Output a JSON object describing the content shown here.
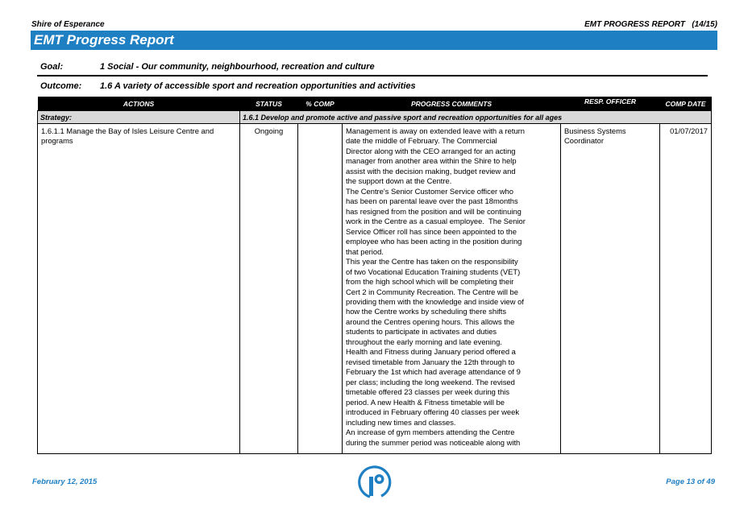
{
  "header": {
    "organisation": "Shire of Esperance",
    "report_label": "EMT PROGRESS REPORT",
    "report_period": "(14/15)",
    "banner_title": "EMT Progress Report"
  },
  "goal": {
    "label": "Goal:",
    "text": "1 Social - Our community, neighbourhood, recreation and culture"
  },
  "outcome": {
    "label": "Outcome:",
    "text": "1.6 A variety of accessible sport and recreation opportunities and activities"
  },
  "table": {
    "columns": [
      "ACTIONS",
      "STATUS",
      "% COMP",
      "PROGRESS COMMENTS",
      "RESP. OFFICER",
      "COMP DATE"
    ],
    "strategy_label": "Strategy:",
    "strategy_text": "1.6.1 Develop and promote active and passive sport and recreation opportunities for all ages",
    "rows": [
      {
        "action": "1.6.1.1 Manage the Bay of Isles Leisure Centre and programs",
        "status": "Ongoing",
        "percent_complete": "",
        "comment_lines": [
          "Management is away on extended leave with a return",
          "date the middle of February. The Commercial",
          "Director along with the CEO arranged for an acting",
          "manager from another area within the Shire to help",
          "assist with the decision making, budget review and",
          "the support down at the Centre.",
          "The Centre's Senior Customer Service officer who",
          "has been on parental leave over the past 18months",
          "has resigned from the position and will be continuing",
          "work in the Centre as a casual employee.  The Senior",
          "Service Officer roll has since been appointed to the",
          "employee who has been acting in the position during",
          "that period.",
          "This year the Centre has taken on the responsibility",
          "of two Vocational Education Training students (VET)",
          "from the high school which will be completing their",
          "Cert 2 in Community Recreation. The Centre will be",
          "providing them with the knowledge and inside view of",
          "how the Centre works by scheduling there shifts",
          "around the Centres opening hours. This allows the",
          "students to participate in activates and duties",
          "throughout the early morning and late evening.",
          "Health and Fitness during January period offered a",
          "revised timetable from January the 12th through to",
          "February the 1st which had average attendance of 9",
          "per class; including the long weekend. The revised",
          "timetable offered 23 classes per week during this",
          "period. A new Health & Fitness timetable will be",
          "introduced in February offering 40 classes per week",
          "including new times and classes.",
          "An increase of gym members attending the Centre",
          "during the summer period was noticeable along with"
        ],
        "responsible_officer": "Business Systems Coordinator",
        "completion_date": "01/07/2017"
      }
    ]
  },
  "footer": {
    "date": "February 12, 2015",
    "page": "Page 13 of 49",
    "logo_icon": "info-i-logo-icon",
    "brand_color": "#1e7fc3"
  }
}
